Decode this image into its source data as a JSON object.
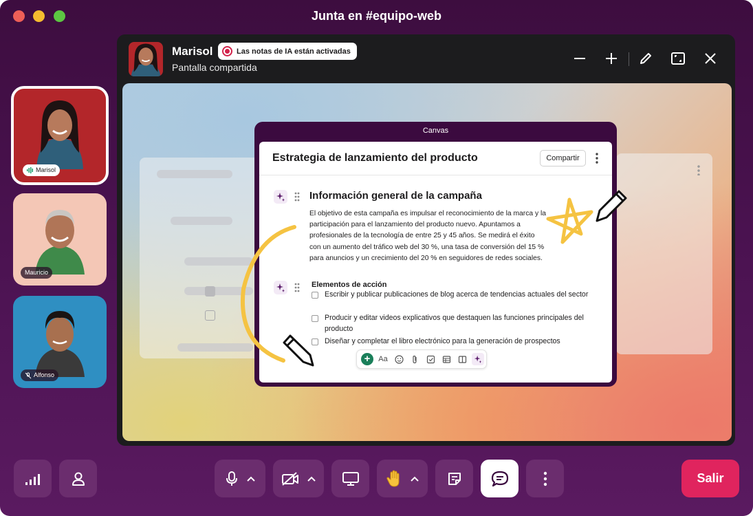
{
  "window": {
    "title": "Junta en #equipo-web"
  },
  "participants": [
    {
      "name": "Marisol",
      "status": "speaking"
    },
    {
      "name": "Mauricio",
      "status": "normal"
    },
    {
      "name": "Alfonso",
      "status": "muted"
    }
  ],
  "share": {
    "presenter_name": "Marisol",
    "ai_notes_badge": "Las notas de IA están activadas",
    "subtitle": "Pantalla compartida"
  },
  "canvas": {
    "label": "Canvas",
    "doc_title": "Estrategia de lanzamiento del producto",
    "share_button": "Compartir",
    "section_heading": "Información general de la campaña",
    "section_body": "El objetivo de esta campaña es impulsar el reconocimiento de la marca y la participación para el lanzamiento del producto nuevo. Apuntamos a profesionales de la tecnología de entre 25 y 45 años. Se medirá el éxito con un aumento del tráfico web del 30 %, una tasa de conversión del 15 % para anuncios y un crecimiento del 20 % en seguidores de redes sociales.",
    "actions_heading": "Elementos de acción",
    "tasks": [
      "Escribir y publicar publicaciones de blog acerca de tendencias actuales del sector",
      "Producir y editar videos explicativos que destaquen las funciones principales del producto",
      "Diseñar y completar el libro electrónico para la generación de prospectos"
    ],
    "toolbar_text_label": "Aa"
  },
  "controls": {
    "exit_label": "Salir"
  },
  "colors": {
    "aubergine": "#4a1250",
    "exit_red": "#e0245e",
    "ai_red": "#d2234b",
    "add_green": "#1a7f5a",
    "doodle_yellow": "#f5c342"
  }
}
